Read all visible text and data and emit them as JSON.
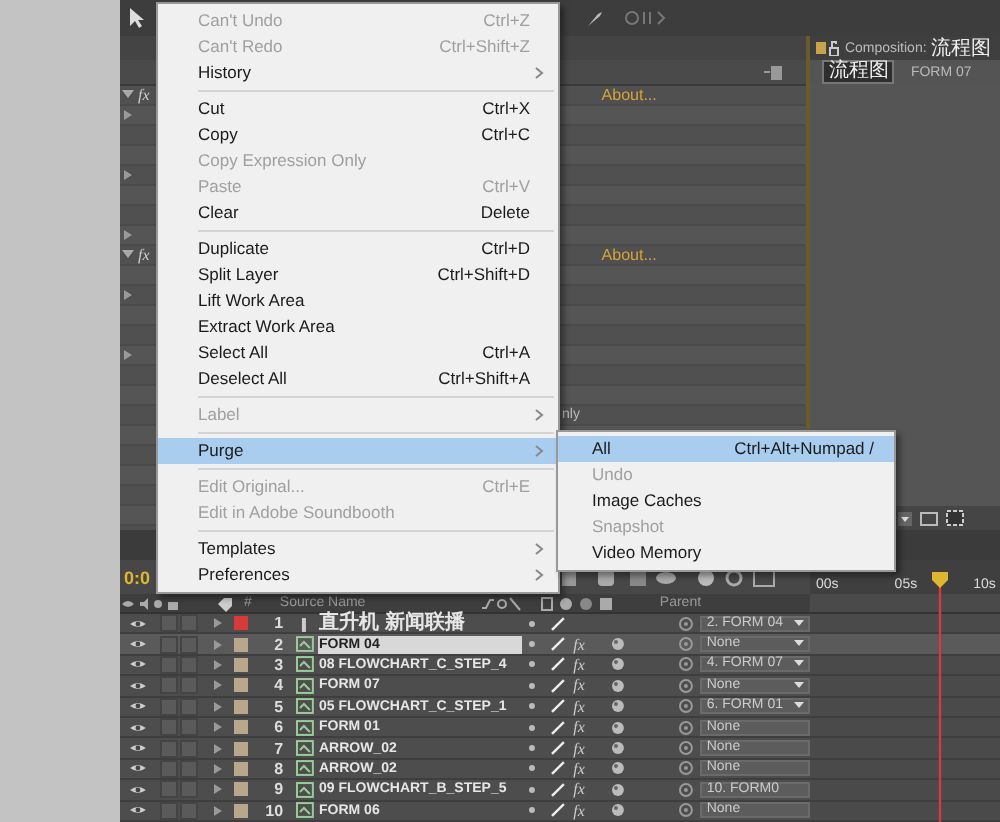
{
  "effects_panel": {
    "rows": [
      {
        "kind": "effect",
        "label": "fx",
        "link": "About..."
      },
      {
        "kind": "effect",
        "label": "fx",
        "link": "About..."
      },
      {
        "kind": "text",
        "label": "nly"
      }
    ]
  },
  "composition_panel": {
    "tab_label": "Composition:",
    "tab_name": "流程图",
    "breadcrumbs": [
      {
        "label": "流程图",
        "selected": true
      },
      {
        "label": "FORM 07",
        "selected": false
      }
    ]
  },
  "edit_menu": {
    "items": [
      {
        "kind": "item",
        "label": "Can't Undo",
        "shortcut": "Ctrl+Z",
        "disabled": true,
        "submenu": false,
        "selected": false
      },
      {
        "kind": "item",
        "label": "Can't Redo",
        "shortcut": "Ctrl+Shift+Z",
        "disabled": true,
        "submenu": false,
        "selected": false
      },
      {
        "kind": "item",
        "label": "History",
        "disabled": false,
        "submenu": true,
        "selected": false
      },
      {
        "kind": "separator"
      },
      {
        "kind": "item",
        "label": "Cut",
        "shortcut": "Ctrl+X",
        "disabled": false,
        "submenu": false,
        "selected": false
      },
      {
        "kind": "item",
        "label": "Copy",
        "shortcut": "Ctrl+C",
        "disabled": false,
        "submenu": false,
        "selected": false
      },
      {
        "kind": "item",
        "label": "Copy Expression Only",
        "disabled": true,
        "submenu": false,
        "selected": false
      },
      {
        "kind": "item",
        "label": "Paste",
        "shortcut": "Ctrl+V",
        "disabled": true,
        "submenu": false,
        "selected": false
      },
      {
        "kind": "item",
        "label": "Clear",
        "shortcut": "Delete",
        "disabled": false,
        "submenu": false,
        "selected": false
      },
      {
        "kind": "separator"
      },
      {
        "kind": "item",
        "label": "Duplicate",
        "shortcut": "Ctrl+D",
        "disabled": false,
        "submenu": false,
        "selected": false
      },
      {
        "kind": "item",
        "label": "Split Layer",
        "shortcut": "Ctrl+Shift+D",
        "disabled": false,
        "submenu": false,
        "selected": false
      },
      {
        "kind": "item",
        "label": "Lift Work Area",
        "disabled": false,
        "submenu": false,
        "selected": false
      },
      {
        "kind": "item",
        "label": "Extract Work Area",
        "disabled": false,
        "submenu": false,
        "selected": false
      },
      {
        "kind": "item",
        "label": "Select All",
        "shortcut": "Ctrl+A",
        "disabled": false,
        "submenu": false,
        "selected": false
      },
      {
        "kind": "item",
        "label": "Deselect All",
        "shortcut": "Ctrl+Shift+A",
        "disabled": false,
        "submenu": false,
        "selected": false
      },
      {
        "kind": "separator"
      },
      {
        "kind": "item",
        "label": "Label",
        "disabled": true,
        "submenu": true,
        "selected": false
      },
      {
        "kind": "separator"
      },
      {
        "kind": "item",
        "label": "Purge",
        "disabled": false,
        "submenu": true,
        "selected": true
      },
      {
        "kind": "separator"
      },
      {
        "kind": "item",
        "label": "Edit Original...",
        "shortcut": "Ctrl+E",
        "disabled": true,
        "submenu": false,
        "selected": false
      },
      {
        "kind": "item",
        "label": "Edit in Adobe Soundbooth",
        "disabled": true,
        "submenu": false,
        "selected": false
      },
      {
        "kind": "separator"
      },
      {
        "kind": "item",
        "label": "Templates",
        "disabled": false,
        "submenu": true,
        "selected": false
      },
      {
        "kind": "item",
        "label": "Preferences",
        "disabled": false,
        "submenu": true,
        "selected": false
      }
    ]
  },
  "purge_submenu": {
    "items": [
      {
        "label": "All",
        "shortcut": "Ctrl+Alt+Numpad /",
        "disabled": false,
        "selected": true
      },
      {
        "label": "Undo",
        "disabled": true,
        "selected": false
      },
      {
        "label": "Image Caches",
        "disabled": false,
        "selected": false
      },
      {
        "label": "Snapshot",
        "disabled": true,
        "selected": false
      },
      {
        "label": "Video Memory",
        "disabled": false,
        "selected": false
      }
    ]
  },
  "timeline": {
    "time": "0:0",
    "ruler": [
      "00s",
      "05s",
      "10s"
    ],
    "columns": {
      "number": "#",
      "source_name": "Source Name",
      "parent": "Parent"
    },
    "layers": [
      {
        "number": "1",
        "name": "直升机 新闻联播",
        "kind": "text",
        "color": "#d83a3a",
        "parent": "2. FORM 04",
        "dropdown": true,
        "selected": false
      },
      {
        "number": "2",
        "name": "FORM 04",
        "kind": "comp",
        "effect_switch": "fx",
        "color": "#b9a78c",
        "parent": "None",
        "dropdown": true,
        "selected": true
      },
      {
        "number": "3",
        "name": "08 FLOWCHART_C_STEP_4",
        "kind": "comp",
        "effect_switch": "fx",
        "color": "#b9a78c",
        "parent": "4. FORM 07",
        "dropdown": true,
        "selected": false
      },
      {
        "number": "4",
        "name": "FORM 07",
        "kind": "comp",
        "effect_switch": "fx",
        "color": "#b9a78c",
        "parent": "None",
        "dropdown": true,
        "selected": false
      },
      {
        "number": "5",
        "name": "05 FLOWCHART_C_STEP_1",
        "kind": "comp",
        "effect_switch": "fx",
        "color": "#b9a78c",
        "parent": "6. FORM 01",
        "dropdown": true,
        "selected": false
      },
      {
        "number": "6",
        "name": "FORM 01",
        "kind": "comp",
        "effect_switch": "fx",
        "color": "#b9a78c",
        "parent": "None",
        "dropdown": false,
        "selected": false
      },
      {
        "number": "7",
        "name": "ARROW_02",
        "kind": "comp",
        "effect_switch": "fx",
        "color": "#b9a78c",
        "parent": "None",
        "dropdown": false,
        "selected": false
      },
      {
        "number": "8",
        "name": "ARROW_02",
        "kind": "comp",
        "effect_switch": "fx",
        "color": "#b9a78c",
        "parent": "None",
        "dropdown": false,
        "selected": false
      },
      {
        "number": "9",
        "name": "09 FLOWCHART_B_STEP_5",
        "kind": "comp",
        "effect_switch": "fx",
        "color": "#b9a78c",
        "parent": "10. FORM0",
        "dropdown": false,
        "selected": false
      },
      {
        "number": "10",
        "name": "FORM 06",
        "kind": "comp",
        "effect_switch": "fx",
        "color": "#b9a78c",
        "parent": "None",
        "dropdown": false,
        "selected": false
      }
    ]
  }
}
